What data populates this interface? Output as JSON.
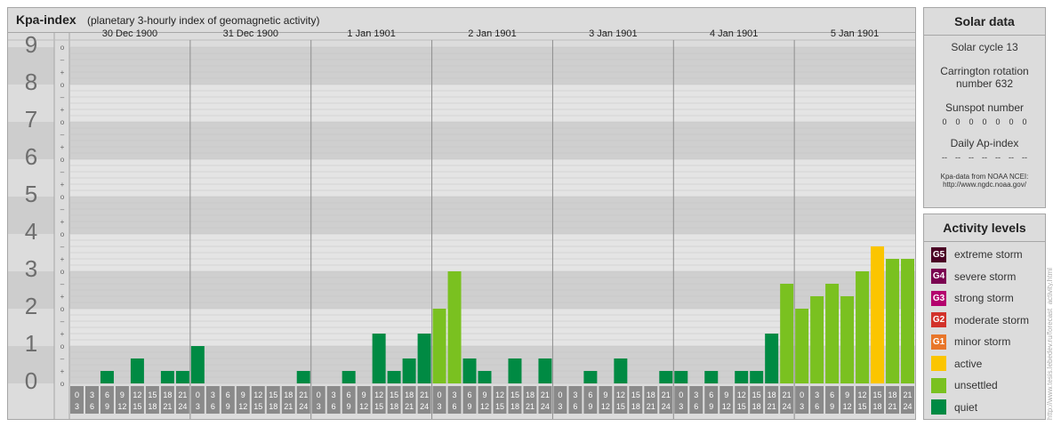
{
  "header": {
    "title": "Kpa-index",
    "subtitle": "(planetary 3-hourly index of geomagnetic activity)"
  },
  "chart_data": {
    "type": "bar",
    "title": "Kpa-index",
    "subtitle": "(planetary 3-hourly index of geomagnetic activity)",
    "ylim": [
      0,
      9
    ],
    "y_ticks": [
      "0",
      "1",
      "2",
      "3",
      "4",
      "5",
      "6",
      "7",
      "8",
      "9"
    ],
    "sub_ticks": [
      "o",
      "+",
      "–"
    ],
    "days": [
      "30 Dec 1900",
      "31 Dec 1900",
      "1 Jan 1901",
      "2 Jan 1901",
      "3 Jan 1901",
      "4 Jan 1901",
      "5 Jan 1901"
    ],
    "interval_labels": [
      [
        "0",
        "3"
      ],
      [
        "3",
        "6"
      ],
      [
        "6",
        "9"
      ],
      [
        "9",
        "12"
      ],
      [
        "12",
        "15"
      ],
      [
        "15",
        "18"
      ],
      [
        "18",
        "21"
      ],
      [
        "21",
        "24"
      ]
    ],
    "values": [
      0,
      0,
      0.333,
      0,
      0.667,
      0,
      0.333,
      0.333,
      1,
      0,
      0,
      0,
      0,
      0,
      0,
      0.333,
      0,
      0,
      0.333,
      0,
      1.333,
      0.333,
      0.667,
      1.333,
      2,
      3,
      0.667,
      0.333,
      0,
      0.667,
      0,
      0.667,
      0,
      0,
      0.333,
      0,
      0.667,
      0,
      0,
      0.333,
      0.333,
      0,
      0.333,
      0,
      0.333,
      0.333,
      1.333,
      2.667,
      2,
      2.333,
      2.667,
      2.333,
      3,
      3.667,
      3.333,
      3.333
    ],
    "colors": {
      "quiet": "#008a43",
      "unsettled": "#7ac120",
      "active": "#fbc500"
    },
    "grid": true
  },
  "solar": {
    "title": "Solar data",
    "cycle": "Solar cycle 13",
    "carrington_line1": "Carrington rotation",
    "carrington_line2": "number 632",
    "sunspot_label": "Sunspot number",
    "sunspot_values": [
      "0",
      "0",
      "0",
      "0",
      "0",
      "0",
      "0"
    ],
    "ap_label": "Daily Ap-index",
    "ap_values": [
      "--",
      "--",
      "--",
      "--",
      "--",
      "--",
      "--"
    ],
    "source_line1": "Kpa-data from NOAA NCEI:",
    "source_line2": "http://www.ngdc.noaa.gov/"
  },
  "activity": {
    "title": "Activity levels",
    "items": [
      {
        "code": "G5",
        "label": "extreme storm",
        "color": "#4a0024"
      },
      {
        "code": "G4",
        "label": "severe storm",
        "color": "#7a0050"
      },
      {
        "code": "G3",
        "label": "strong storm",
        "color": "#b4006e"
      },
      {
        "code": "G2",
        "label": "moderate storm",
        "color": "#d2322a"
      },
      {
        "code": "G1",
        "label": "minor storm",
        "color": "#e8762a"
      },
      {
        "code": "",
        "label": "active",
        "color": "#fbc500"
      },
      {
        "code": "",
        "label": "unsettled",
        "color": "#7ac120"
      },
      {
        "code": "",
        "label": "quiet",
        "color": "#008a43"
      }
    ]
  },
  "credit": "http://www.tesis.lebedev.ru/forecast_activity.html"
}
